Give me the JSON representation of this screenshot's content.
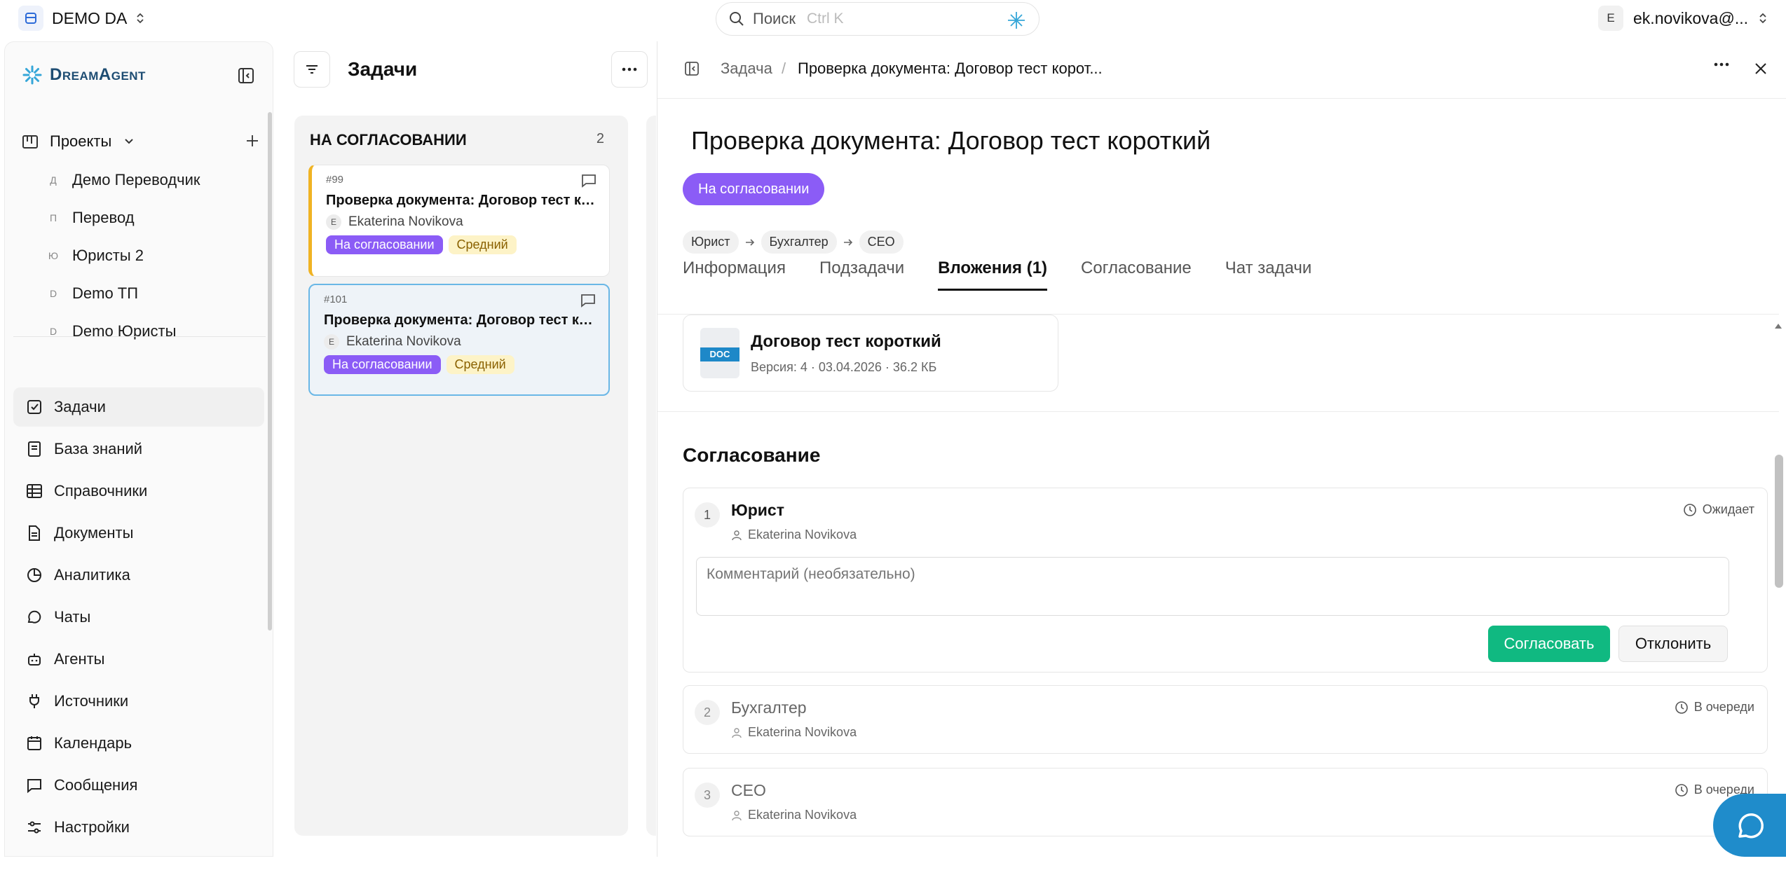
{
  "workspace": {
    "name": "DEMO DA"
  },
  "search": {
    "placeholder": "Поиск",
    "shortcut": "Ctrl K"
  },
  "user": {
    "initial": "E",
    "email": "ek.novikova@..."
  },
  "sidebar": {
    "logo": "DreamAgent",
    "projects_label": "Проекты",
    "projects": [
      {
        "letter": "Д",
        "name": "Демо Переводчик"
      },
      {
        "letter": "П",
        "name": "Перевод"
      },
      {
        "letter": "Ю",
        "name": "Юристы 2"
      },
      {
        "letter": "D",
        "name": "Demo ТП"
      },
      {
        "letter": "D",
        "name": "Demo Юристы"
      }
    ],
    "nav": [
      {
        "label": "Задачи",
        "icon": "checkbox-icon"
      },
      {
        "label": "База знаний",
        "icon": "book-icon"
      },
      {
        "label": "Справочники",
        "icon": "table-icon"
      },
      {
        "label": "Документы",
        "icon": "document-icon"
      },
      {
        "label": "Аналитика",
        "icon": "pie-chart-icon"
      },
      {
        "label": "Чаты",
        "icon": "chat-icon"
      },
      {
        "label": "Агенты",
        "icon": "bot-icon"
      },
      {
        "label": "Источники",
        "icon": "plug-icon"
      },
      {
        "label": "Календарь",
        "icon": "calendar-icon"
      },
      {
        "label": "Сообщения",
        "icon": "message-icon"
      },
      {
        "label": "Настройки",
        "icon": "settings-icon"
      }
    ]
  },
  "tasks": {
    "title": "Задачи",
    "column": {
      "title": "НА СОГЛАСОВАНИИ",
      "count": "2"
    },
    "cards": [
      {
        "num": "#99",
        "title": "Проверка документа: Договор тест ко...",
        "initial": "E",
        "assignee": "Ekaterina Novikova",
        "status": "На согласовании",
        "priority": "Средний"
      },
      {
        "num": "#101",
        "title": "Проверка документа: Договор тест ко...",
        "initial": "E",
        "assignee": "Ekaterina Novikova",
        "status": "На согласовании",
        "priority": "Средний"
      }
    ]
  },
  "detail": {
    "breadcrumb": {
      "parent": "Задача",
      "sep": "/",
      "current": "Проверка документа: Договор тест корот..."
    },
    "title": "Проверка документа: Договор тест короткий",
    "status": "На согласовании",
    "chain": [
      "Юрист",
      "Бухгалтер",
      "CEO"
    ],
    "tabs": [
      "Информация",
      "Подзадачи",
      "Вложения (1)",
      "Согласование",
      "Чат задачи"
    ],
    "attachment": {
      "badge": "DOC",
      "name": "Договор тест короткий",
      "meta": "Версия: 4 · 03.04.2026 · 36.2 КБ"
    },
    "approval": {
      "title": "Согласование",
      "comment_placeholder": "Комментарий (необязательно)",
      "approve": "Согласовать",
      "reject": "Отклонить",
      "steps": [
        {
          "n": "1",
          "role": "Юрист",
          "person": "Ekaterina Novikova",
          "state": "Ожидает"
        },
        {
          "n": "2",
          "role": "Бухгалтер",
          "person": "Ekaterina Novikova",
          "state": "В очереди"
        },
        {
          "n": "3",
          "role": "CEO",
          "person": "Ekaterina Novikova",
          "state": "В очереди"
        }
      ]
    }
  },
  "colors": {
    "accent": "#8b5cf6",
    "approve": "#10b981",
    "selected_border": "#6ab7e6",
    "card_stripe": "#f0b323",
    "fab": "#1f8ccb"
  }
}
